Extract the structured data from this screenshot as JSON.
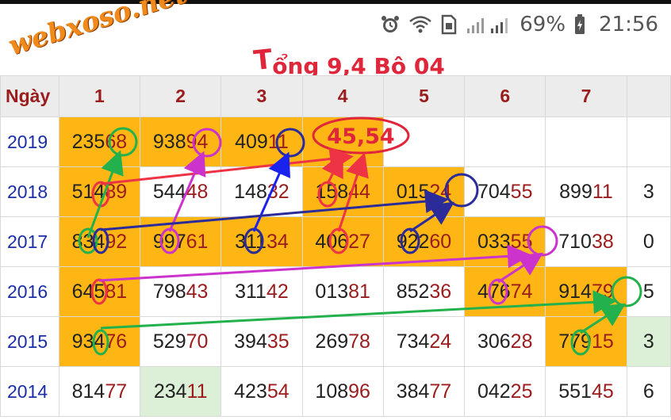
{
  "status": {
    "battery": "69%",
    "time": "21:56",
    "icons": [
      "alarm-icon",
      "wifi-icon",
      "sim-icon",
      "signal-icon",
      "battery-icon"
    ]
  },
  "watermark": "webxoso.net",
  "headline": {
    "big": "T",
    "rest": "ổng 9,4 Bộ 04"
  },
  "annotation": "45,54",
  "colors": {
    "highlight": "#fdb614",
    "light_green": "#dcefd7",
    "header_text": "#9b1c1c",
    "year_text": "#1a2fa8",
    "annotation_red": "#e0263a"
  },
  "table": {
    "header_label": "Ngày",
    "columns": [
      "1",
      "2",
      "3",
      "4",
      "5",
      "6",
      "7",
      ""
    ],
    "rows": [
      {
        "year": "2019",
        "cells": [
          {
            "a": "235",
            "b": "68",
            "bg": "hl"
          },
          {
            "a": "938",
            "b": "94",
            "bg": "hl"
          },
          {
            "a": "409",
            "b": "11",
            "bg": "hl"
          },
          {
            "a": "",
            "b": "",
            "bg": "hl"
          },
          {
            "a": "",
            "b": "",
            "bg": ""
          },
          {
            "a": "",
            "b": "",
            "bg": ""
          },
          {
            "a": "",
            "b": "",
            "bg": ""
          },
          {
            "a": "",
            "b": "",
            "bg": ""
          }
        ]
      },
      {
        "year": "2018",
        "cells": [
          {
            "a": "514",
            "b": "89",
            "bg": "hl"
          },
          {
            "a": "544",
            "b": "48",
            "bg": ""
          },
          {
            "a": "148",
            "b": "32",
            "bg": ""
          },
          {
            "a": "158",
            "b": "44",
            "bg": "hl"
          },
          {
            "a": "015",
            "b": "24",
            "bg": "hl"
          },
          {
            "a": "704",
            "b": "55",
            "bg": ""
          },
          {
            "a": "899",
            "b": "11",
            "bg": ""
          },
          {
            "a": "3",
            "b": "",
            "bg": ""
          }
        ]
      },
      {
        "year": "2017",
        "cells": [
          {
            "a": "834",
            "b": "92",
            "bg": "hl"
          },
          {
            "a": "997",
            "b": "61",
            "bg": "hl"
          },
          {
            "a": "311",
            "b": "34",
            "bg": "hl"
          },
          {
            "a": "406",
            "b": "27",
            "bg": "hl"
          },
          {
            "a": "922",
            "b": "60",
            "bg": "hl"
          },
          {
            "a": "033",
            "b": "55",
            "bg": "hl"
          },
          {
            "a": "710",
            "b": "38",
            "bg": ""
          },
          {
            "a": "0",
            "b": "",
            "bg": ""
          }
        ]
      },
      {
        "year": "2016",
        "cells": [
          {
            "a": "645",
            "b": "81",
            "bg": "hl"
          },
          {
            "a": "798",
            "b": "43",
            "bg": ""
          },
          {
            "a": "311",
            "b": "42",
            "bg": ""
          },
          {
            "a": "013",
            "b": "81",
            "bg": ""
          },
          {
            "a": "852",
            "b": "36",
            "bg": ""
          },
          {
            "a": "476",
            "b": "74",
            "bg": "hl"
          },
          {
            "a": "914",
            "b": "79",
            "bg": "hl"
          },
          {
            "a": "5",
            "b": "",
            "bg": ""
          }
        ]
      },
      {
        "year": "2015",
        "cells": [
          {
            "a": "934",
            "b": "76",
            "bg": "hl"
          },
          {
            "a": "529",
            "b": "70",
            "bg": ""
          },
          {
            "a": "394",
            "b": "35",
            "bg": ""
          },
          {
            "a": "269",
            "b": "78",
            "bg": ""
          },
          {
            "a": "734",
            "b": "24",
            "bg": ""
          },
          {
            "a": "306",
            "b": "28",
            "bg": ""
          },
          {
            "a": "779",
            "b": "15",
            "bg": "hl"
          },
          {
            "a": "3",
            "b": "",
            "bg": "gr"
          }
        ]
      },
      {
        "year": "2014",
        "cells": [
          {
            "a": "814",
            "b": "77",
            "bg": ""
          },
          {
            "a": "234",
            "b": "11",
            "bg": "gr"
          },
          {
            "a": "423",
            "b": "54",
            "bg": ""
          },
          {
            "a": "108",
            "b": "96",
            "bg": ""
          },
          {
            "a": "384",
            "b": "77",
            "bg": ""
          },
          {
            "a": "042",
            "b": "25",
            "bg": ""
          },
          {
            "a": "551",
            "b": "45",
            "bg": ""
          },
          {
            "a": "6",
            "b": "",
            "bg": ""
          }
        ]
      }
    ]
  }
}
